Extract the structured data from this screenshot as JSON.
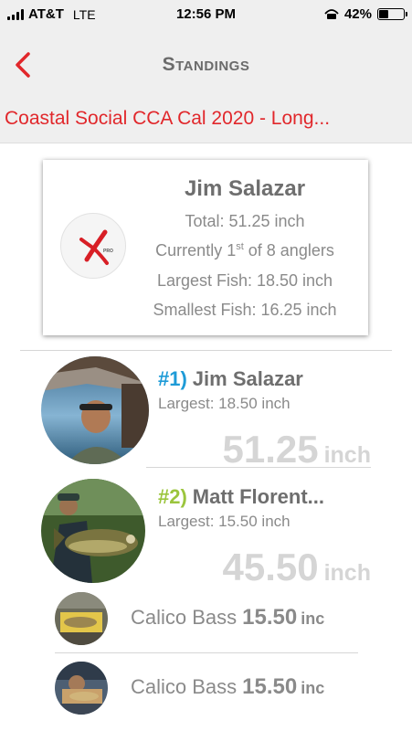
{
  "status_bar": {
    "carrier": "AT&T",
    "network": "LTE",
    "time": "12:56 PM",
    "battery": "42%",
    "battery_fraction": 0.42
  },
  "nav": {
    "back_icon": "chevron-left-icon",
    "title": "Standings",
    "accent": "#e1272b"
  },
  "tournament": {
    "title": "Coastal Social CCA Cal 2020 - Long..."
  },
  "summary": {
    "name": "Jim Salazar",
    "total": "Total: 51.25 inch",
    "rank_pre": "Currently 1",
    "rank_sup": "st",
    "rank_post": " of 8 anglers",
    "largest": "Largest Fish:  18.50 inch",
    "smallest": "Smallest Fish:  16.25 inch",
    "logo_icon": "x-brand-logo"
  },
  "standings": [
    {
      "rank": "#1)",
      "rank_color": "#1e9bd7",
      "name": "Jim Salazar",
      "largest": "Largest:  18.50 inch",
      "total": "51.25",
      "unit": "inch"
    },
    {
      "rank": "#2)",
      "rank_color": "#9bc53d",
      "name": "Matt Florent...",
      "largest": "Largest:  15.50 inch",
      "total": "45.50",
      "unit": "inch"
    }
  ],
  "catches": [
    {
      "species": "Calico Bass",
      "length": "15.50",
      "unit": "inc"
    },
    {
      "species": "Calico Bass",
      "length": "15.50",
      "unit": "inc"
    }
  ]
}
